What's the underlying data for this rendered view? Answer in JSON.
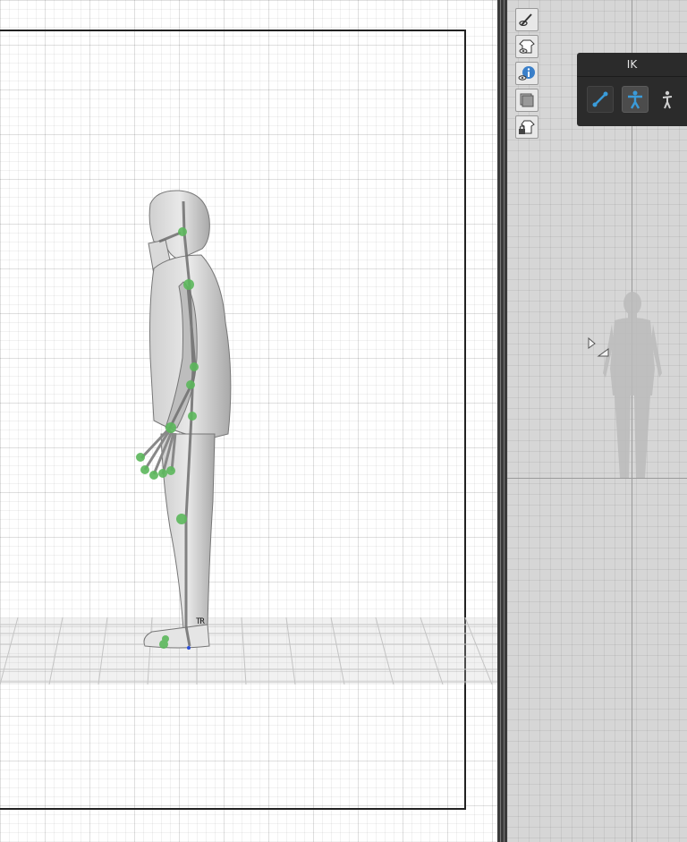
{
  "ik_panel": {
    "title": "IK",
    "buttons": [
      {
        "name": "bone-tool",
        "icon": "bone-icon"
      },
      {
        "name": "full-body-ik",
        "icon": "body-ik-icon"
      },
      {
        "name": "pose-mode",
        "icon": "figure-icon"
      }
    ]
  },
  "tool_icons": [
    {
      "name": "visibility-brush",
      "icon": "eye-brush-icon"
    },
    {
      "name": "visibility-clothing",
      "icon": "eye-shirt-icon"
    },
    {
      "name": "visibility-info",
      "icon": "eye-info-icon"
    },
    {
      "name": "layer-stack",
      "icon": "layers-icon"
    },
    {
      "name": "lock-clothing",
      "icon": "lock-shirt-icon"
    }
  ],
  "viewport": {
    "marker_label": "TR"
  },
  "colors": {
    "accent": "#3a9bd9",
    "joint": "#5cb85c",
    "panel_bg": "#2b2b2b"
  }
}
